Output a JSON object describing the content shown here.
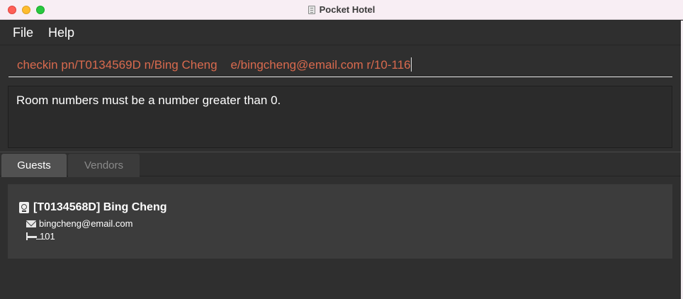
{
  "window": {
    "title": "Pocket Hotel"
  },
  "menu": {
    "items": [
      "File",
      "Help"
    ]
  },
  "command": {
    "value": "checkin pn/T0134569D n/Bing Cheng    e/bingcheng@email.com r/10-116"
  },
  "result": {
    "message": "Room numbers must be a number greater than 0."
  },
  "tabs": [
    {
      "label": "Guests",
      "active": true
    },
    {
      "label": "Vendors",
      "active": false
    }
  ],
  "guests": [
    {
      "header": "[T0134568D] Bing Cheng",
      "email": "bingcheng@email.com",
      "room": "101"
    }
  ],
  "colors": {
    "command_text": "#d96a4e",
    "background": "#2f2f2f",
    "card": "#3c3c3c"
  }
}
